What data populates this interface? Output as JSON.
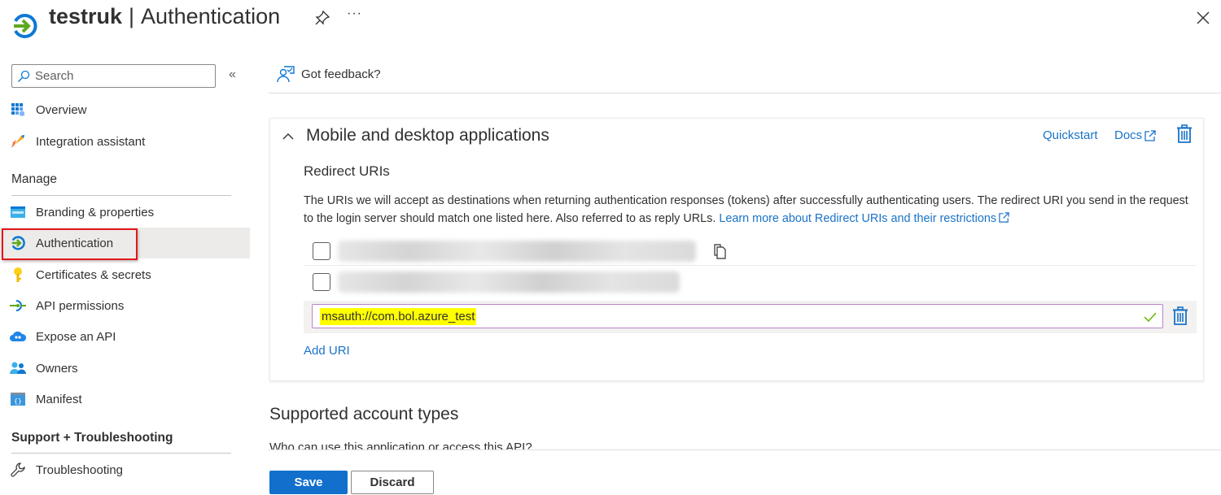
{
  "header": {
    "app_name": "testruk",
    "separator": "|",
    "page_title": "Authentication",
    "more_label": "···"
  },
  "sidebar": {
    "search_placeholder": "Search",
    "collapse_label": "«",
    "items_top": [
      {
        "label": "Overview",
        "icon": "overview-icon"
      },
      {
        "label": "Integration assistant",
        "icon": "rocket-icon"
      }
    ],
    "manage_heading": "Manage",
    "manage_items": [
      {
        "label": "Branding & properties",
        "icon": "branding-icon"
      },
      {
        "label": "Authentication",
        "icon": "authentication-icon",
        "active": true
      },
      {
        "label": "Certificates & secrets",
        "icon": "key-icon"
      },
      {
        "label": "API permissions",
        "icon": "api-permissions-icon"
      },
      {
        "label": "Expose an API",
        "icon": "cloud-icon"
      },
      {
        "label": "Owners",
        "icon": "owners-icon"
      },
      {
        "label": "Manifest",
        "icon": "manifest-icon"
      }
    ],
    "support_heading": "Support + Troubleshooting",
    "support_items": [
      {
        "label": "Troubleshooting",
        "icon": "wrench-icon"
      }
    ]
  },
  "main": {
    "feedback_label": "Got feedback?",
    "card": {
      "title": "Mobile and desktop applications",
      "quickstart_label": "Quickstart",
      "docs_label": "Docs",
      "redirect_title": "Redirect URIs",
      "redirect_description": "The URIs we will accept as destinations when returning authentication responses (tokens) after successfully authenticating users. The redirect URI you send in the request to the login server should match one listed here. Also referred to as reply URLs.",
      "learn_more_label": "Learn more about Redirect URIs and their restrictions",
      "uris": [
        {
          "value": "(blurred)",
          "checked": false
        },
        {
          "value": "(blurred)",
          "checked": false
        }
      ],
      "editing_uri": "msauth://com.bol.azure_test",
      "add_uri_label": "Add URI"
    },
    "supported_accounts_title": "Supported account types",
    "supported_accounts_sub": "Who can use this application or access this API?"
  },
  "footer": {
    "save_label": "Save",
    "discard_label": "Discard"
  },
  "colors": {
    "accent": "#1270cc",
    "link": "#1a73c8",
    "highlight": "#ffff00",
    "active_bg": "#edebe9",
    "callout_red": "#e3171b",
    "valid_green": "#6bb700"
  }
}
